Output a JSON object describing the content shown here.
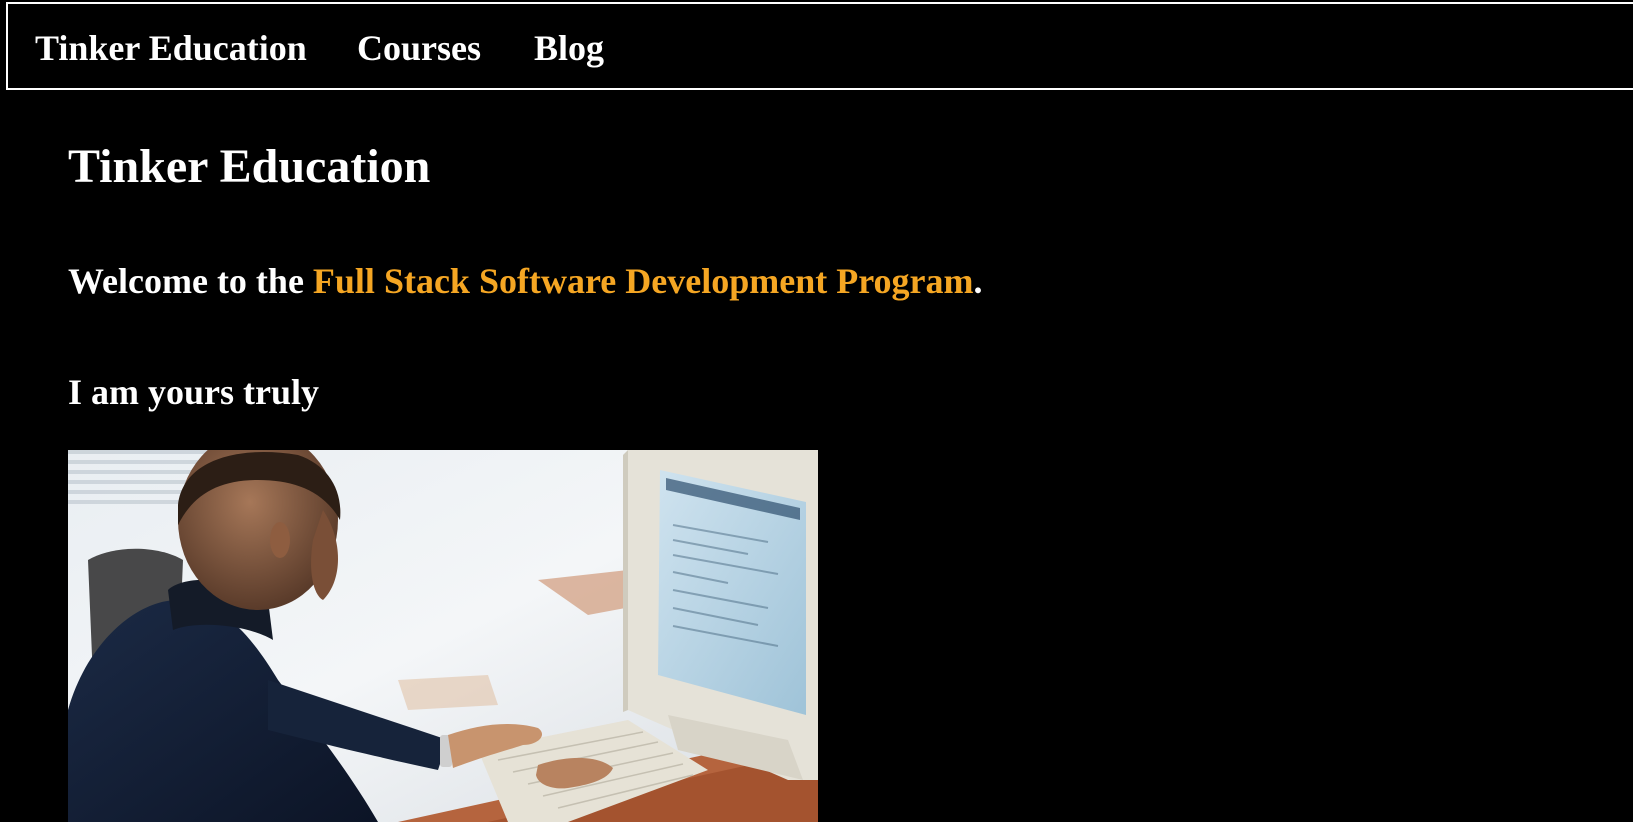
{
  "nav": {
    "brand_label": "Tinker Education",
    "items": [
      {
        "label": "Courses"
      },
      {
        "label": "Blog"
      }
    ],
    "border_color": "#ffffff"
  },
  "main": {
    "title": "Tinker Education",
    "welcome": {
      "prefix": "Welcome to the ",
      "highlight": "Full Stack Software Development Program",
      "suffix": ".",
      "highlight_color": "#f5a623"
    },
    "subtitle": "I am yours truly",
    "photo": {
      "alt": "Man in dark jacket typing on a keyboard in front of a computer monitor"
    }
  },
  "colors": {
    "background": "#000000",
    "text": "#ffffff",
    "accent": "#f5a623"
  }
}
